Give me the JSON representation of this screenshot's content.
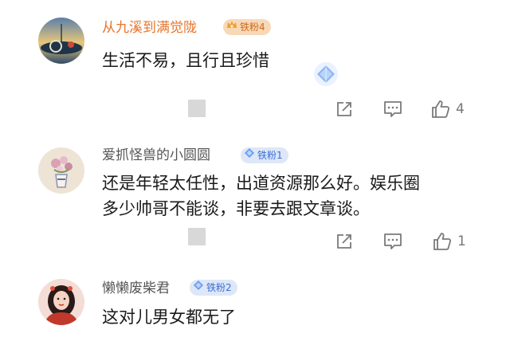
{
  "comments": [
    {
      "username": "从九溪到满觉陇",
      "username_color": "#e8742a",
      "badge": {
        "text": "铁粉4",
        "bg": "#f7d9b8",
        "color": "#d06a1a",
        "style": "crown"
      },
      "content_lines": [
        "生活不易，且行且珍惜"
      ],
      "likes": "4",
      "avatar_icon": "landscape-avatar"
    },
    {
      "username": "爱抓怪兽的小圆圆",
      "username_color": "#555555",
      "badge": {
        "text": "铁粉1",
        "bg": "#dde7f7",
        "color": "#3b6fd6",
        "style": "gem"
      },
      "content_lines": [
        "还是年轻太任性，出道资源那么好。娱乐圈",
        "多少帅哥不能谈，非要去跟文章谈。"
      ],
      "likes": "1",
      "avatar_icon": "flower-vase-avatar"
    },
    {
      "username": "懒懒废柴君",
      "username_color": "#555555",
      "badge": {
        "text": "铁粉2",
        "bg": "#dde7f7",
        "color": "#3b6fd6",
        "style": "gem"
      },
      "content_lines": [
        "这对儿男女都无了"
      ],
      "avatar_icon": "girl-portrait-avatar"
    }
  ],
  "colors": {
    "icon_gray": "#7a7a7a",
    "text_dark": "#1a1a1a"
  }
}
